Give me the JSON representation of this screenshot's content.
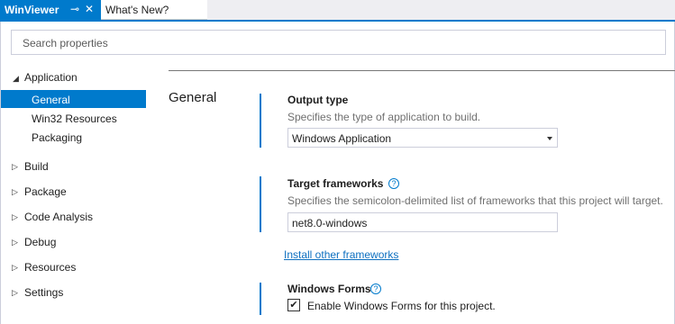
{
  "tabs": [
    {
      "label": "WinViewer",
      "pin_glyph": "⊸",
      "close_glyph": "✕",
      "active": true
    },
    {
      "label": "What's New?",
      "active": false
    }
  ],
  "search": {
    "placeholder": "Search properties"
  },
  "sidebar": {
    "groups": [
      {
        "label": "Application",
        "expanded": true,
        "arrow": "◢",
        "children": [
          {
            "label": "General",
            "selected": true
          },
          {
            "label": "Win32 Resources"
          },
          {
            "label": "Packaging"
          }
        ]
      },
      {
        "label": "Build",
        "arrow": "▷"
      },
      {
        "label": "Package",
        "arrow": "▷"
      },
      {
        "label": "Code Analysis",
        "arrow": "▷"
      },
      {
        "label": "Debug",
        "arrow": "▷"
      },
      {
        "label": "Resources",
        "arrow": "▷"
      },
      {
        "label": "Settings",
        "arrow": "▷"
      }
    ]
  },
  "main": {
    "section_title": "General",
    "output_type": {
      "title": "Output type",
      "description": "Specifies the type of application to build.",
      "value": "Windows Application"
    },
    "target_frameworks": {
      "title": "Target frameworks",
      "help_glyph": "?",
      "description": "Specifies the semicolon-delimited list of frameworks that this project will target.",
      "value": "net8.0-windows",
      "link": "Install other frameworks"
    },
    "windows_forms": {
      "title": "Windows Forms",
      "help_glyph": "?",
      "checkbox_label": "Enable Windows Forms for this project.",
      "checked": true,
      "check_glyph": "✔"
    }
  },
  "colors": {
    "accent": "#007acc",
    "link": "#0e70c0",
    "muted": "#707070"
  }
}
